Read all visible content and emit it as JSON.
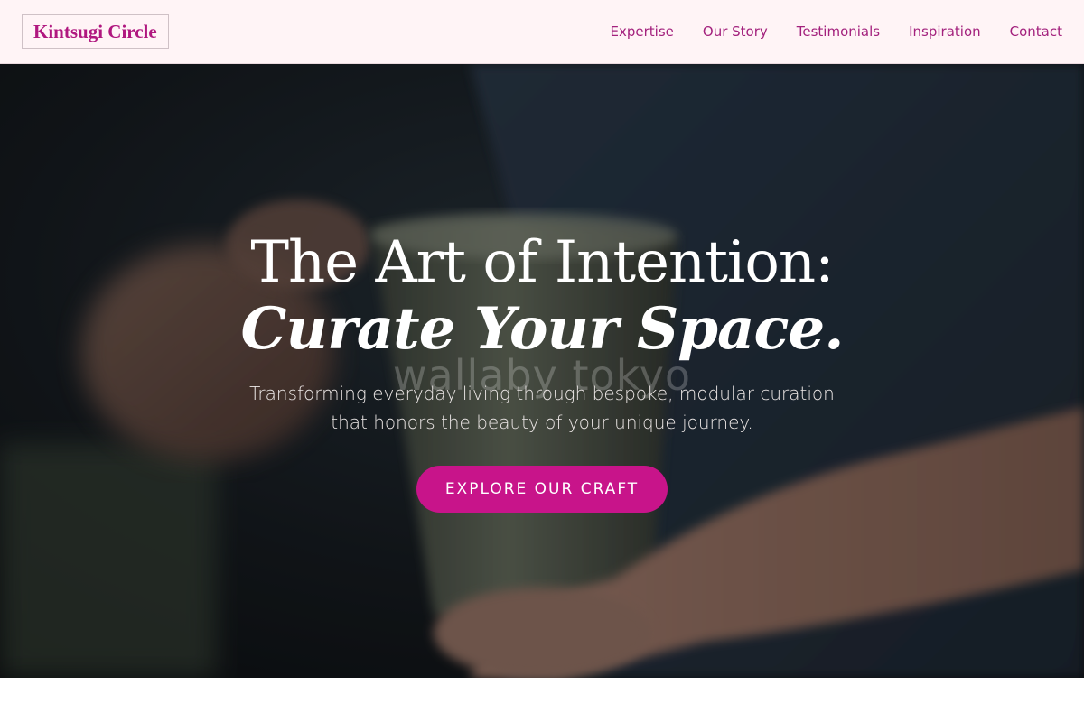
{
  "header": {
    "logo": "Kintsugi Circle",
    "nav": [
      {
        "label": "Expertise"
      },
      {
        "label": "Our Story"
      },
      {
        "label": "Testimonials"
      },
      {
        "label": "Inspiration"
      },
      {
        "label": "Contact"
      }
    ]
  },
  "hero": {
    "title_line1": "The Art of Intention:",
    "title_line2": "Curate Your Space.",
    "subtitle": "Transforming everyday living through bespoke, modular curation that honors the beauty of your unique journey.",
    "cta_label": "EXPLORE OUR CRAFT",
    "watermark": "wallaby tokyo",
    "image_subject": "hands-holding-ceramic-mug"
  },
  "colors": {
    "brand": "#b0177f",
    "nav_text": "#a3217d",
    "header_bg": "#fff4f6",
    "cta_bg": "#c8148a"
  }
}
